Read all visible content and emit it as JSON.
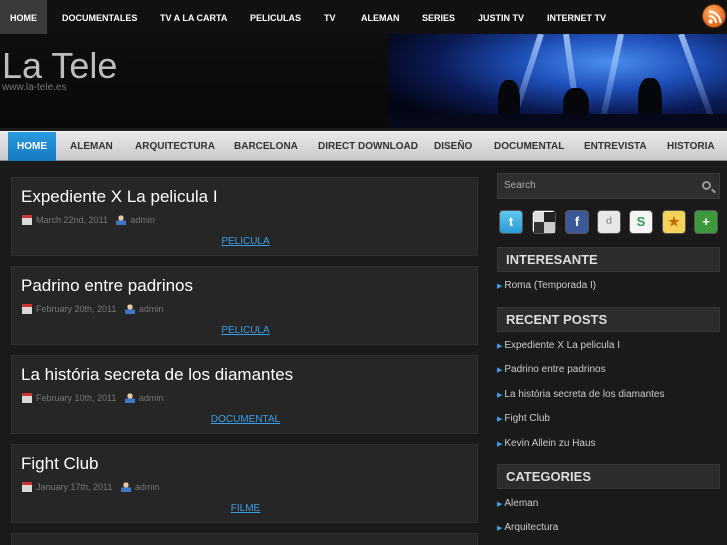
{
  "top_nav": [
    "HOME",
    "DOCUMENTALES",
    "TV A LA CARTA",
    "PELICULAS",
    "TV",
    "ALEMAN",
    "SERIES",
    "JUSTIN TV",
    "INTERNET TV"
  ],
  "site": {
    "title": "La Tele",
    "url": "www.la-tele.es"
  },
  "main_nav": [
    "HOME",
    "ALEMAN",
    "ARQUITECTURA",
    "BARCELONA",
    "DIRECT DOWNLOAD",
    "DISEÑO",
    "DOCUMENTAL",
    "ENTREVISTA",
    "HISTORIA"
  ],
  "posts": [
    {
      "title": "Expediente X La pelicula I",
      "date": "March 22nd, 2011",
      "author": "admin",
      "category": "PELICULA"
    },
    {
      "title": "Padrino entre padrinos",
      "date": "February 20th, 2011",
      "author": "admin",
      "category": "PELICULA"
    },
    {
      "title": "La história secreta de los diamantes",
      "date": "February 10th, 2011",
      "author": "admin",
      "category": "DOCUMENTAL"
    },
    {
      "title": "Fight Club",
      "date": "January 17th, 2011",
      "author": "admin",
      "category": "FILME"
    }
  ],
  "sidebar": {
    "search_placeholder": "Search",
    "social_icons": [
      "twitter-icon",
      "delicious-icon",
      "facebook-icon",
      "digg-icon",
      "stumbleupon-icon",
      "favorites-icon",
      "add-icon"
    ],
    "interesante": {
      "title": "INTERESANTE",
      "items": [
        "Roma (Temporada I)"
      ]
    },
    "recent_posts": {
      "title": "RECENT POSTS",
      "items": [
        "Expediente X La pelicula I",
        "Padrino entre padrinos",
        "La história secreta de los diamantes",
        "Fight Club",
        "Kevin Allein zu Haus"
      ]
    },
    "categories": {
      "title": "CATEGORIES",
      "items": [
        "Aleman",
        "Arquitectura"
      ]
    }
  },
  "colors": {
    "accent_blue": "#1e8ad6",
    "link_blue": "#3a9ee6",
    "rss_orange": "#e4661a"
  }
}
